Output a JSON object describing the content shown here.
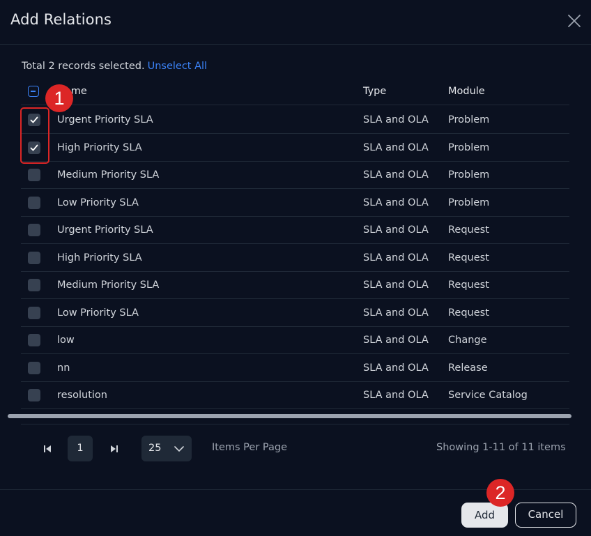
{
  "dialog": {
    "title": "Add Relations",
    "close_icon": "close-icon"
  },
  "selection": {
    "summary": "Total 2 records selected.",
    "unselect_all": "Unselect All"
  },
  "table": {
    "columns": [
      "Name",
      "Type",
      "Module"
    ],
    "rows": [
      {
        "name": "Urgent Priority SLA",
        "type": "SLA and OLA",
        "module": "Problem",
        "checked": true
      },
      {
        "name": "High Priority SLA",
        "type": "SLA and OLA",
        "module": "Problem",
        "checked": true
      },
      {
        "name": "Medium Priority SLA",
        "type": "SLA and OLA",
        "module": "Problem",
        "checked": false
      },
      {
        "name": "Low Priority SLA",
        "type": "SLA and OLA",
        "module": "Problem",
        "checked": false
      },
      {
        "name": "Urgent Priority SLA",
        "type": "SLA and OLA",
        "module": "Request",
        "checked": false
      },
      {
        "name": "High Priority SLA",
        "type": "SLA and OLA",
        "module": "Request",
        "checked": false
      },
      {
        "name": "Medium Priority SLA",
        "type": "SLA and OLA",
        "module": "Request",
        "checked": false
      },
      {
        "name": "Low Priority SLA",
        "type": "SLA and OLA",
        "module": "Request",
        "checked": false
      },
      {
        "name": "low",
        "type": "SLA and OLA",
        "module": "Change",
        "checked": false
      },
      {
        "name": "nn",
        "type": "SLA and OLA",
        "module": "Release",
        "checked": false
      },
      {
        "name": "resolution",
        "type": "SLA and OLA",
        "module": "Service Catalog",
        "checked": false
      }
    ]
  },
  "pagination": {
    "current_page": "1",
    "per_page": "25",
    "per_page_label": "Items Per Page",
    "showing": "Showing 1-11 of 11 items"
  },
  "footer": {
    "add_label": "Add",
    "cancel_label": "Cancel"
  },
  "annotations": {
    "marker_1": "1",
    "marker_2": "2"
  },
  "colors": {
    "background": "#0b1120",
    "accent": "#3b82f6",
    "annotation": "#dc2626"
  }
}
